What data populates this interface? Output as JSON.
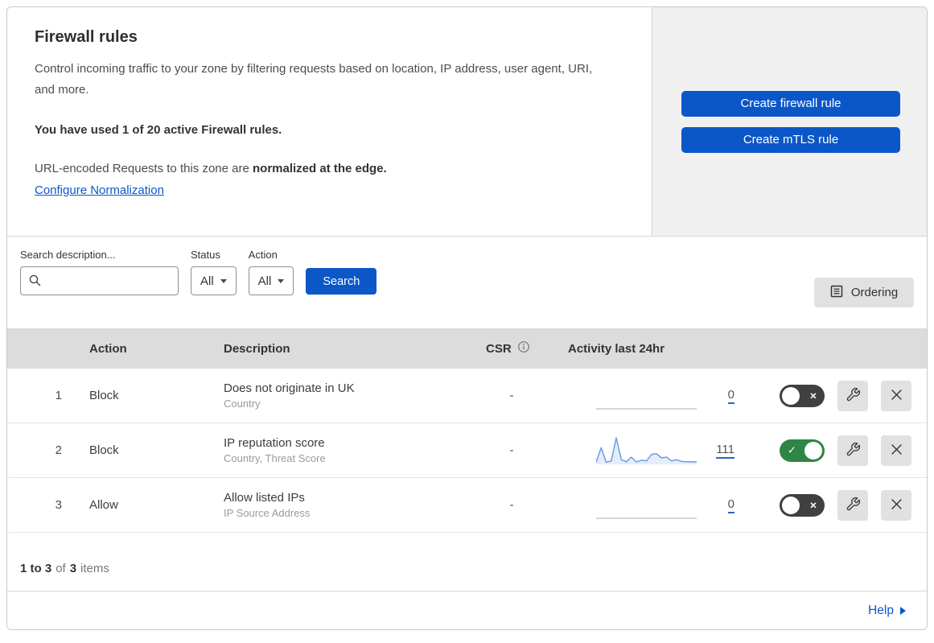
{
  "header": {
    "title": "Firewall rules",
    "description": "Control incoming traffic to your zone by filtering requests based on location, IP address, user agent, URI, and more.",
    "usage_note": "You have used 1 of 20 active Firewall rules.",
    "normalization_prefix": "URL-encoded Requests to this zone are ",
    "normalization_bold": "normalized at the edge.",
    "normalization_link": "Configure Normalization",
    "create_firewall_button": "Create firewall rule",
    "create_mtls_button": "Create mTLS rule"
  },
  "filters": {
    "search_label": "Search description...",
    "search_value": "",
    "status_label": "Status",
    "status_value": "All",
    "action_label": "Action",
    "action_value": "All",
    "search_button": "Search",
    "ordering_button": "Ordering"
  },
  "table": {
    "columns": {
      "action": "Action",
      "description": "Description",
      "csr": "CSR",
      "activity": "Activity last 24hr"
    },
    "rows": [
      {
        "priority": "1",
        "action": "Block",
        "description": "Does not originate in UK",
        "fields": "Country",
        "csr": "-",
        "activity_count": "0",
        "enabled": false,
        "sparkline": []
      },
      {
        "priority": "2",
        "action": "Block",
        "description": "IP reputation score",
        "fields": "Country, Threat Score",
        "csr": "-",
        "activity_count": "111",
        "enabled": true,
        "sparkline": [
          5,
          62,
          5,
          10,
          100,
          15,
          7,
          25,
          6,
          13,
          10,
          35,
          38,
          22,
          25,
          10,
          15,
          8,
          7,
          7,
          6
        ]
      },
      {
        "priority": "3",
        "action": "Allow",
        "description": "Allow listed IPs",
        "fields": "IP Source Address",
        "csr": "-",
        "activity_count": "0",
        "enabled": false,
        "sparkline": []
      }
    ]
  },
  "footer": {
    "range": "1 to 3",
    "of_text": "of",
    "total": "3",
    "items_text": "items",
    "help_label": "Help"
  },
  "icons": {
    "search": "magnifier",
    "status_caret": "triangle-down",
    "action_caret": "triangle-down",
    "ordering": "list-page",
    "csr_info": "info-circle",
    "toggle_on_glyph": "check",
    "toggle_off_glyph": "x",
    "edit": "wrench",
    "delete": "x",
    "help_arrow": "triangle-right"
  },
  "colors": {
    "primary_blue": "#0b57c8",
    "link_blue": "#0b57c8",
    "toggle_on_green": "#2f8546",
    "toggle_off_gray": "#404042",
    "sparkline_blue": "#6d9de6",
    "sparkline_flat_gray": "#c9c9c9",
    "table_header_bg": "#dcdcdc",
    "panel_gray": "#f0f0f0"
  }
}
